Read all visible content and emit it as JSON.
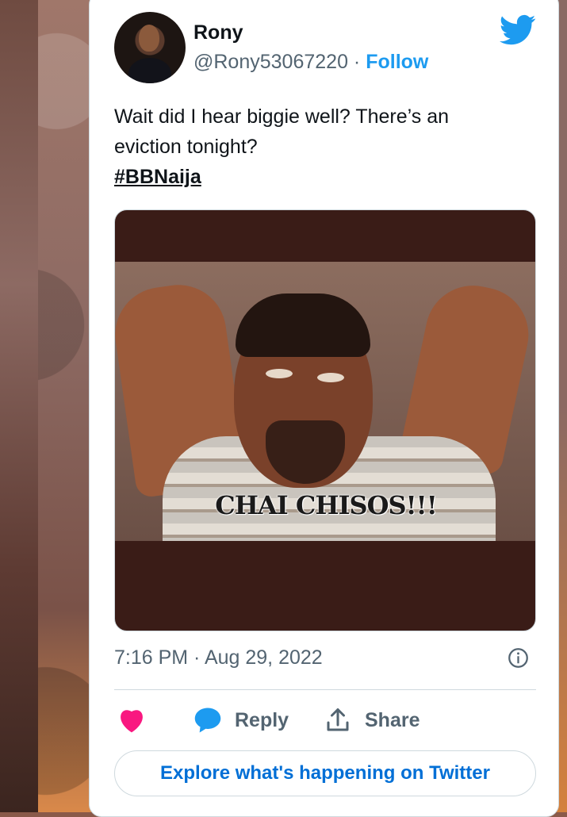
{
  "tweet": {
    "author": {
      "name": "Rony",
      "handle": "@Rony53067220",
      "separator": " · ",
      "follow_label": "Follow"
    },
    "text_line1": "Wait did I hear biggie well? There’s an",
    "text_line2": "eviction tonight?",
    "hashtag": "#BBNaija",
    "media": {
      "caption": "CHAI CHISOS!!!"
    },
    "timestamp": "7:16 PM · Aug 29, 2022",
    "actions": {
      "reply_label": "Reply",
      "share_label": "Share"
    },
    "explore_label": "Explore what's happening on Twitter"
  },
  "colors": {
    "twitter_blue": "#1d9bf0",
    "like_pink": "#f91880",
    "explore_link": "#006fd6",
    "secondary_text": "#536471"
  },
  "icons": [
    "twitter-bird-icon",
    "info-icon",
    "heart-icon",
    "reply-bubble-icon",
    "share-icon"
  ]
}
